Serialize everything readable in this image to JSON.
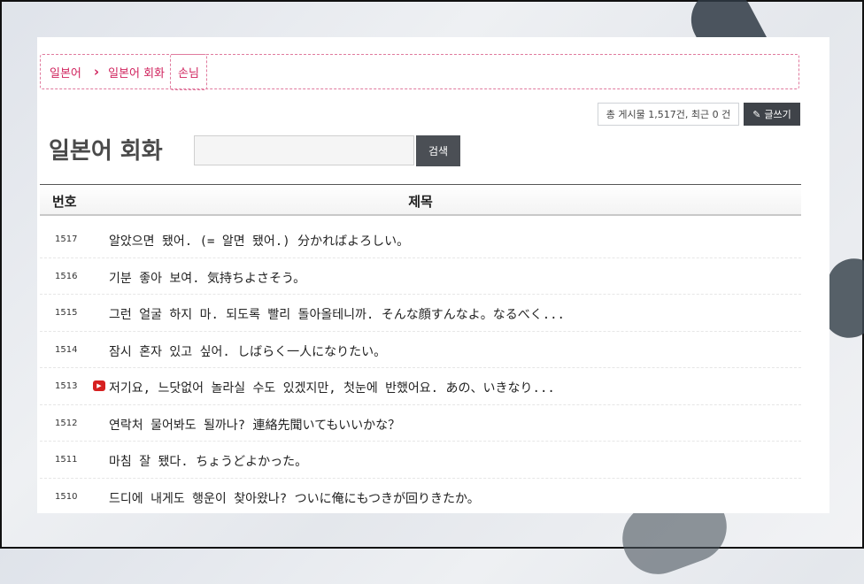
{
  "breadcrumb": {
    "items": [
      "일본어",
      "일본어 회화"
    ],
    "separator": "›",
    "current": "손님"
  },
  "stats": {
    "text": "총 게시물 1,517건, 최근 0 건"
  },
  "toolbar": {
    "write_label": "글쓰기"
  },
  "page_title": "일본어 회화",
  "search": {
    "value": "",
    "button_label": "검색"
  },
  "table": {
    "headers": {
      "num": "번호",
      "title": "제목"
    },
    "rows": [
      {
        "num": "1517",
        "title": "알았으면 됐어. (= 알면 됐어.) 分かればよろしい。",
        "video": false
      },
      {
        "num": "1516",
        "title": "기분 좋아 보여. 気持ちよさそう。",
        "video": false
      },
      {
        "num": "1515",
        "title": "그런 얼굴 하지 마. 되도록 빨리 돌아올테니까. そんな顔すんなよ。なるべく...",
        "video": false
      },
      {
        "num": "1514",
        "title": "잠시 혼자 있고 싶어. しばらく一人になりたい。",
        "video": false
      },
      {
        "num": "1513",
        "title": "저기요, 느닷없어 놀라실 수도 있겠지만, 첫눈에 반했어요. あの、いきなり...",
        "video": true
      },
      {
        "num": "1512",
        "title": "연락처 물어봐도 될까나? 連絡先聞いてもいいかな？",
        "video": false
      },
      {
        "num": "1511",
        "title": "마침 잘 됐다. ちょうどよかった。",
        "video": false
      },
      {
        "num": "1510",
        "title": "드디에 내게도 행운이 찾아왔나? ついに俺にもつきが回りきたか。",
        "video": false
      }
    ]
  },
  "colors": {
    "accent": "#d0245e",
    "dark_button": "#3f4349"
  },
  "icons": {
    "video": "youtube-icon",
    "write": "pencil-icon"
  }
}
